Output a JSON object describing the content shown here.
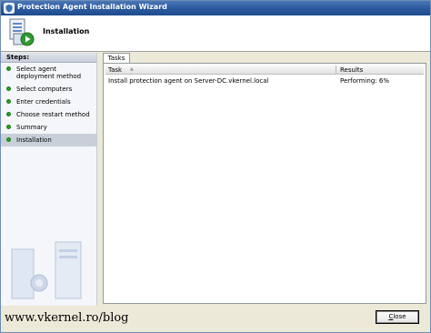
{
  "window": {
    "title": "Protection Agent Installation Wizard"
  },
  "header": {
    "title": "Installation"
  },
  "sidebar": {
    "heading": "Steps:",
    "items": [
      {
        "label": "Select agent deployment method",
        "active": false
      },
      {
        "label": "Select computers",
        "active": false
      },
      {
        "label": "Enter credentials",
        "active": false
      },
      {
        "label": "Choose restart method",
        "active": false
      },
      {
        "label": "Summary",
        "active": false
      },
      {
        "label": "Installation",
        "active": true
      }
    ]
  },
  "tabs": [
    {
      "label": "Tasks",
      "selected": true
    }
  ],
  "table": {
    "columns": [
      "Task",
      "Results"
    ],
    "rows": [
      {
        "task": "Install protection agent on Server-DC.vkernel.local",
        "result": "Performing: 6%"
      }
    ]
  },
  "footer": {
    "close_label": "Close",
    "close_underlined": "C",
    "close_rest": "lose"
  },
  "watermark": {
    "text": "www.vkernel.ro/blog"
  },
  "colors": {
    "titlebar": "#2c5a9e",
    "step_bullet": "#27a321",
    "active_step_bg": "#c9cfd9"
  }
}
